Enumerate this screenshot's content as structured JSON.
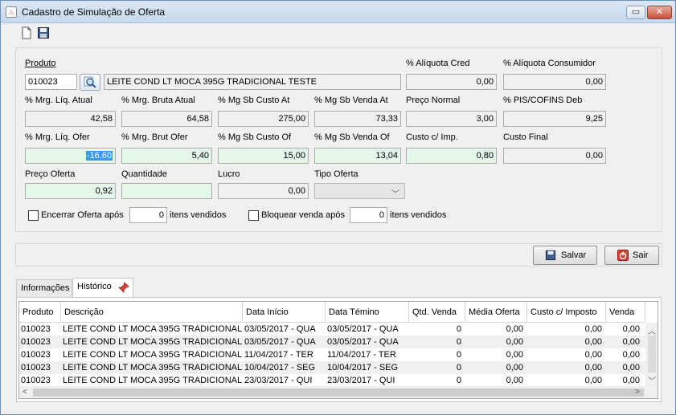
{
  "window": {
    "title": "Cadastro de Simulação de Oferta"
  },
  "icons": {
    "new": "new-document-icon",
    "save": "floppy-disk-icon",
    "search": "magnifier-icon",
    "pin": "pin-icon",
    "exit": "power-icon"
  },
  "form": {
    "produto_label": "Produto",
    "produto_code": "010023",
    "produto_desc": "LEITE COND LT MOCA 395G TRADICIONAL TESTE",
    "aliq_cred_label": "% Alíquota Cred",
    "aliq_cred": "0,00",
    "aliq_cons_label": "% Alíquota Consumidor",
    "aliq_cons": "0,00",
    "mrg_liq_atual_label": "% Mrg. Líq. Atual",
    "mrg_liq_atual": "42,58",
    "mrg_bruta_atual_label": "% Mrg. Bruta Atual",
    "mrg_bruta_atual": "64,58",
    "mg_sb_custo_at_label": "% Mg Sb Custo At",
    "mg_sb_custo_at": "275,00",
    "mg_sb_venda_at_label": "% Mg Sb Venda At",
    "mg_sb_venda_at": "73,33",
    "preco_normal_label": "Preço Normal",
    "preco_normal": "3,00",
    "pis_cofins_label": "% PIS/COFINS Deb",
    "pis_cofins": "9,25",
    "mrg_liq_ofer_label": "% Mrg. Líq. Ofer",
    "mrg_liq_ofer": "-16,60",
    "mrg_brut_ofer_label": "% Mrg. Brut Ofer",
    "mrg_brut_ofer": "5,40",
    "mg_sb_custo_of_label": "% Mg Sb Custo Of",
    "mg_sb_custo_of": "15,00",
    "mg_sb_venda_of_label": "% Mg Sb Venda Of",
    "mg_sb_venda_of": "13,04",
    "custo_imp_label": "Custo c/ Imp.",
    "custo_imp": "0,80",
    "custo_final_label": "Custo Final",
    "custo_final": "0,00",
    "preco_oferta_label": "Preço Oferta",
    "preco_oferta": "0,92",
    "quantidade_label": "Quantidade",
    "quantidade": "",
    "lucro_label": "Lucro",
    "lucro": "0,00",
    "tipo_oferta_label": "Tipo Oferta",
    "tipo_oferta": "",
    "encerrar_label": "Encerrar Oferta após",
    "encerrar_value": "0",
    "encerrar_suffix": "itens vendidos",
    "bloquear_label": "Bloquear venda após",
    "bloquear_value": "0",
    "bloquear_suffix": "itens vendidos"
  },
  "buttons": {
    "salvar": "Salvar",
    "sair": "Sair"
  },
  "tabs": [
    {
      "label": "Informações"
    },
    {
      "label": "Histórico"
    }
  ],
  "grid": {
    "columns": [
      "Produto",
      "Descrição",
      "Data Início",
      "Data Témino",
      "Qtd. Venda",
      "Média Oferta",
      "Custo c/ Imposto",
      "Venda"
    ],
    "rows": [
      [
        "010023",
        "LEITE COND LT MOCA 395G TRADICIONAL ...",
        "03/05/2017 - QUA",
        "03/05/2017 - QUA",
        "0",
        "0,00",
        "0,00",
        "0,00"
      ],
      [
        "010023",
        "LEITE COND LT MOCA 395G TRADICIONAL ...",
        "03/05/2017 - QUA",
        "03/05/2017 - QUA",
        "0",
        "0,00",
        "0,00",
        "0,00"
      ],
      [
        "010023",
        "LEITE COND LT MOCA 395G TRADICIONAL ...",
        "11/04/2017 - TER",
        "11/04/2017 - TER",
        "0",
        "0,00",
        "0,00",
        "0,00"
      ],
      [
        "010023",
        "LEITE COND LT MOCA 395G TRADICIONAL ...",
        "10/04/2017 - SEG",
        "10/04/2017 - SEG",
        "0",
        "0,00",
        "0,00",
        "0,00"
      ],
      [
        "010023",
        "LEITE COND LT MOCA 395G TRADICIONAL ...",
        "23/03/2017 - QUI",
        "23/03/2017 - QUI",
        "0",
        "0,00",
        "0,00",
        "0,00"
      ]
    ]
  }
}
